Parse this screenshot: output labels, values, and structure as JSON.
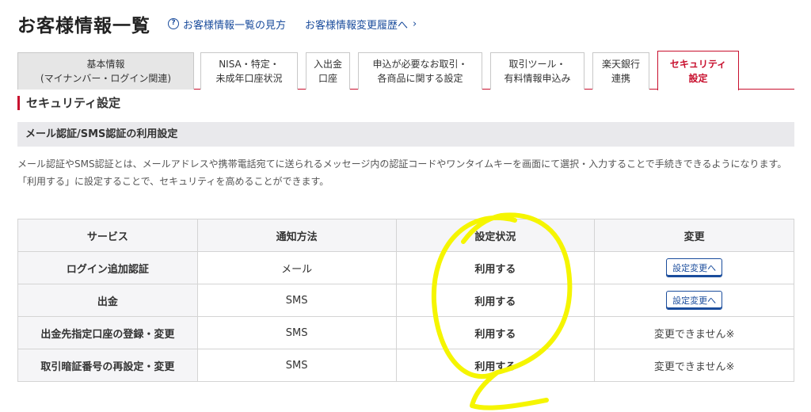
{
  "header": {
    "title": "お客様情報一覧",
    "help_icon": "question-circle-icon",
    "help_link": "お客様情報一覧の見方",
    "history_link": "お客様情報変更履歴へ",
    "chevron": "›"
  },
  "tabs": [
    {
      "line1": "基本情報",
      "line2": "(マイナンバー・ログイン関連)"
    },
    {
      "line1": "NISA・特定・",
      "line2": "未成年口座状況"
    },
    {
      "line1": "入出金",
      "line2": "口座"
    },
    {
      "line1": "申込が必要なお取引・",
      "line2": "各商品に関する設定"
    },
    {
      "line1": "取引ツール・",
      "line2": "有料情報申込み"
    },
    {
      "line1": "楽天銀行",
      "line2": "連携"
    },
    {
      "line1": "セキュリティ",
      "line2": "設定"
    }
  ],
  "section_title": "セキュリティ設定",
  "sub_title": "メール認証/SMS認証の利用設定",
  "description": {
    "line1": "メール認証やSMS認証とは、メールアドレスや携帯電話宛てに送られるメッセージ内の認証コードやワンタイムキーを画面にて選択・入力することで手続きできるようになります。",
    "line2": "「利用する」に設定することで、セキュリティを高めることができます。"
  },
  "table": {
    "headers": [
      "サービス",
      "通知方法",
      "設定状況",
      "変更"
    ],
    "rows": [
      {
        "service": "ログイン追加認証",
        "method": "メール",
        "status": "利用する",
        "change": "設定変更へ"
      },
      {
        "service": "出金",
        "method": "SMS",
        "status": "利用する",
        "change": "設定変更へ"
      },
      {
        "service": "出金先指定口座の登録・変更",
        "method": "SMS",
        "status": "利用する",
        "change": "変更できません※"
      },
      {
        "service": "取引暗証番号の再設定・変更",
        "method": "SMS",
        "status": "利用する",
        "change": "変更できません※"
      }
    ]
  },
  "colors": {
    "accent": "#c8102e",
    "link": "#1a4c9c",
    "highlight": "#f5f500"
  }
}
